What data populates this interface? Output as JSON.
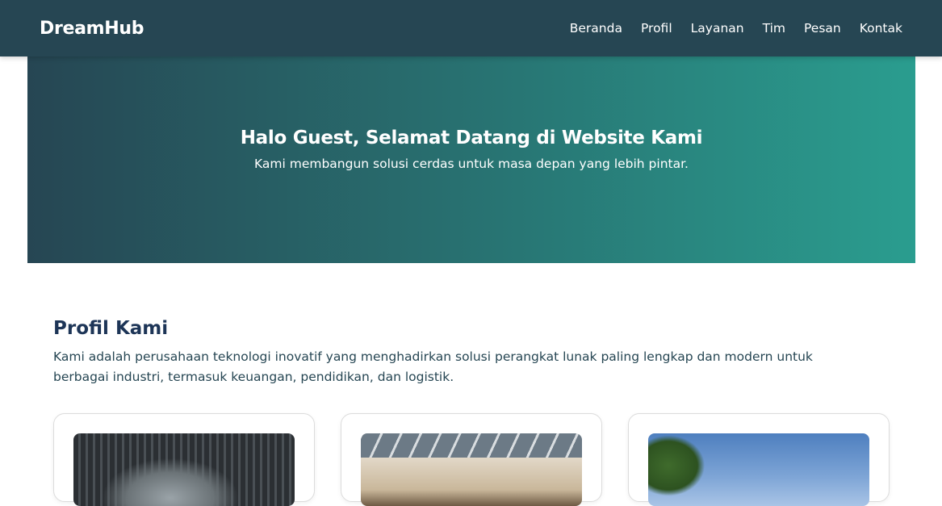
{
  "navbar": {
    "brand": "DreamHub",
    "links": [
      "Beranda",
      "Profil",
      "Layanan",
      "Tim",
      "Pesan",
      "Kontak"
    ]
  },
  "hero": {
    "title": "Halo Guest, Selamat Datang di Website Kami",
    "subtitle": "Kami membangun solusi cerdas untuk masa depan yang lebih pintar."
  },
  "profile": {
    "title": "Profil Kami",
    "description": "Kami adalah perusahaan teknologi inovatif yang menghadirkan solusi perangkat lunak paling lengkap dan modern untuk berbagai industri, termasuk keuangan, pendidikan, dan logistik."
  },
  "colors": {
    "navbar": "#264653",
    "hero_start": "#264653",
    "hero_end": "#2a9d8f",
    "heading": "#1d3557"
  }
}
